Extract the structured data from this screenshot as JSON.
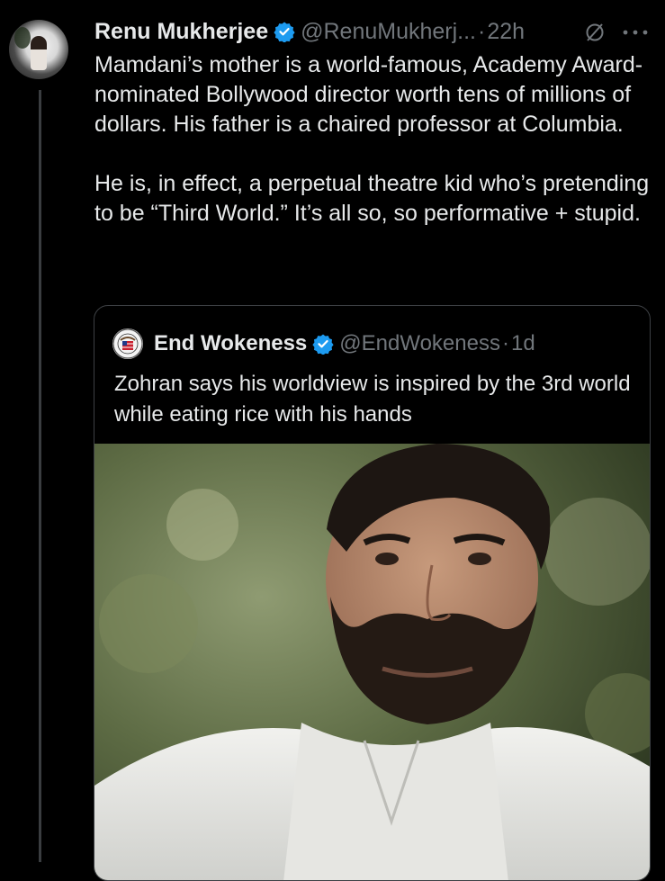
{
  "tweet": {
    "author_name": "Renu Mukherjee",
    "handle": "@RenuMukherj...",
    "separator": "·",
    "time": "22h",
    "paragraph_1": "Mamdani’s mother is a world-famous, Academy Award-nominated Bollywood director worth tens of millions of dollars. His father is a chaired professor at Columbia.",
    "paragraph_2": "He is, in effect, a perpetual theatre kid who’s pretending to be “Third World.” It’s all so, so performative + stupid."
  },
  "quoted_tweet": {
    "author_name": "End Wokeness",
    "handle": "@EndWokeness",
    "separator": "·",
    "time": "1d",
    "text": "Zohran says his worldview is inspired by the 3rd world while eating rice with his hands",
    "media_icon": "photo"
  },
  "colors": {
    "background": "#000000",
    "text_primary": "#e7e9ea",
    "text_secondary": "#71767b",
    "verified_badge": "#1d9bf0",
    "border": "#3d4044"
  },
  "icons": {
    "verified": "verified-badge-icon",
    "grok": "grok-icon",
    "more": "more-icon"
  }
}
